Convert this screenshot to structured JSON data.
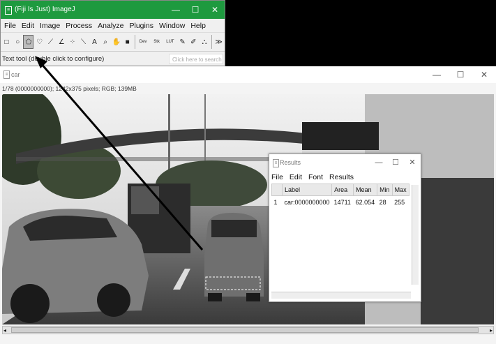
{
  "fiji": {
    "title": "(Fiji Is Just) ImageJ",
    "menus": [
      "File",
      "Edit",
      "Image",
      "Process",
      "Analyze",
      "Plugins",
      "Window",
      "Help"
    ],
    "tools": [
      {
        "name": "rectangle-tool",
        "glyph": "□"
      },
      {
        "name": "oval-tool",
        "glyph": "○"
      },
      {
        "name": "polygon-tool",
        "glyph": "⬠",
        "active": true
      },
      {
        "name": "freehand-tool",
        "glyph": "♡"
      },
      {
        "name": "straight-line-tool",
        "glyph": "⟋"
      },
      {
        "name": "angle-tool",
        "glyph": "∠"
      },
      {
        "name": "point-tool",
        "glyph": "⁘"
      },
      {
        "name": "wand-tool",
        "glyph": "⟍"
      },
      {
        "name": "text-tool",
        "glyph": "A"
      },
      {
        "name": "magnifier-tool",
        "glyph": "⌕"
      },
      {
        "name": "hand-tool",
        "glyph": "✋"
      },
      {
        "name": "color-picker-tool",
        "glyph": "■"
      },
      {
        "name": "dev-tool",
        "glyph": "Dev"
      },
      {
        "name": "stacks-tool",
        "glyph": "Stk"
      },
      {
        "name": "lut-tool",
        "glyph": "LUT"
      },
      {
        "name": "pencil-tool",
        "glyph": "✎"
      },
      {
        "name": "brush-tool",
        "glyph": "✐"
      },
      {
        "name": "flood-fill-tool",
        "glyph": "⛬"
      },
      {
        "name": "more-tools",
        "glyph": "≫"
      }
    ],
    "status": "Text tool (double click to configure)",
    "search_placeholder": "Click here to search"
  },
  "image_window": {
    "title": "car",
    "subtitle": "1/78 (0000000000); 1242x375 pixels; RGB; 139MB"
  },
  "results": {
    "title": "Results",
    "menus": [
      "File",
      "Edit",
      "Font",
      "Results"
    ],
    "columns": [
      "",
      "Label",
      "Area",
      "Mean",
      "Min",
      "Max"
    ],
    "rows": [
      [
        "1",
        "car:0000000000",
        "14711",
        "62.054",
        "28",
        "255"
      ]
    ]
  },
  "colors": {
    "fiji_titlebar": "#1e9a3f",
    "annotation_arrow": "#000000"
  }
}
